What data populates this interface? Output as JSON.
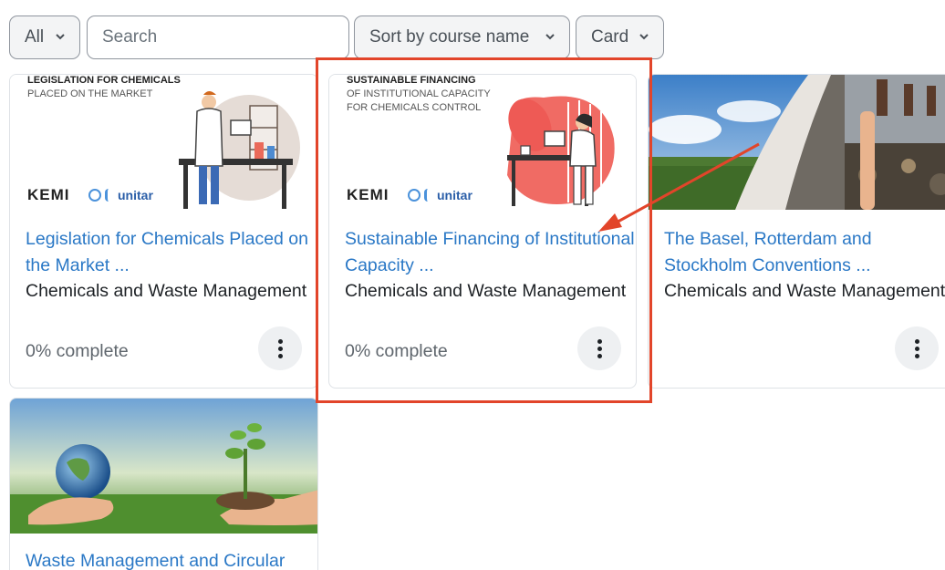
{
  "filters": {
    "grouping": "All",
    "search_placeholder": "Search",
    "sort": "Sort by course name",
    "view": "Card"
  },
  "courses": [
    {
      "title": "Legislation for Chemicals Placed on the Market ...",
      "category": "Chemicals and Waste Management",
      "progress": "0% complete",
      "image_heading": "LEGISLATION FOR CHEMICALS",
      "image_subheading": "PLACED ON THE MARKET",
      "logo_text": "KEMI",
      "partner_text": "unitar"
    },
    {
      "title": "Sustainable Financing of Institutional Capacity ...",
      "category": "Chemicals and Waste Management",
      "progress": "0% complete",
      "image_heading": "SUSTAINABLE FINANCING",
      "image_subheading_1": "OF INSTITUTIONAL CAPACITY",
      "image_subheading_2": "FOR CHEMICALS CONTROL",
      "logo_text": "KEMI",
      "partner_text": "unitar"
    },
    {
      "title": "The Basel, Rotterdam and Stockholm Conventions ...",
      "category": "Chemicals and Waste Management"
    },
    {
      "title": "Waste Management and Circular"
    }
  ],
  "colors": {
    "link": "#2a78c6",
    "highlight": "#e2452a",
    "border": "#dee2e6"
  }
}
